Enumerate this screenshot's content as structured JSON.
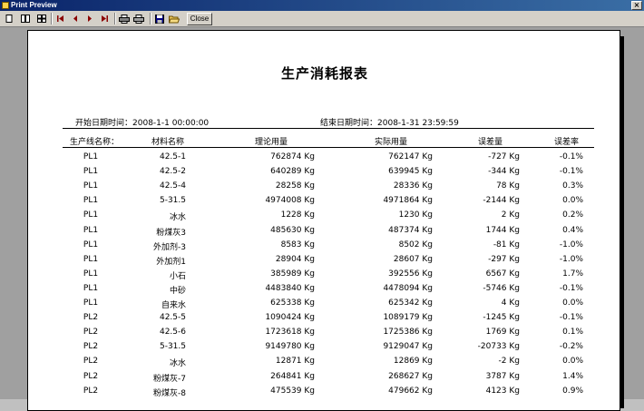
{
  "window": {
    "title": "Print Preview",
    "close_glyph": "×"
  },
  "toolbar": {
    "buttons": [
      {
        "name": "single-page-view",
        "icon": "single-page-icon"
      },
      {
        "name": "two-page-view",
        "icon": "two-page-icon"
      },
      {
        "name": "multi-page-view",
        "icon": "multi-page-icon"
      },
      {
        "name": "first-page",
        "icon": "first-page-icon"
      },
      {
        "name": "previous-page",
        "icon": "previous-page-icon"
      },
      {
        "name": "next-page",
        "icon": "next-page-icon"
      },
      {
        "name": "last-page",
        "icon": "last-page-icon"
      },
      {
        "name": "print-setup",
        "icon": "printer-setup-icon"
      },
      {
        "name": "print",
        "icon": "printer-icon"
      },
      {
        "name": "save",
        "icon": "floppy-disk-icon"
      },
      {
        "name": "open",
        "icon": "open-folder-icon"
      }
    ],
    "close_label": "Close"
  },
  "report": {
    "title": "生产消耗报表",
    "start_label": "开始日期时间：",
    "start_value": "2008-1-1 00:00:00",
    "end_label": "结束日期时间：",
    "end_value": "2008-1-31 23:59:59",
    "columns": [
      "生产线名称：",
      "材料名称",
      "理论用量",
      "实际用量",
      "误差量",
      "误差率"
    ],
    "rows": [
      {
        "line": "PL1",
        "material": "42.5-1",
        "theoretical": "762874 Kg",
        "actual": "762147 Kg",
        "error": "-727 Kg",
        "rate": "-0.1%"
      },
      {
        "line": "PL1",
        "material": "42.5-2",
        "theoretical": "640289 Kg",
        "actual": "639945 Kg",
        "error": "-344 Kg",
        "rate": "-0.1%"
      },
      {
        "line": "PL1",
        "material": "42.5-4",
        "theoretical": "28258 Kg",
        "actual": "28336 Kg",
        "error": "78 Kg",
        "rate": "0.3%"
      },
      {
        "line": "PL1",
        "material": "5-31.5",
        "theoretical": "4974008 Kg",
        "actual": "4971864 Kg",
        "error": "-2144 Kg",
        "rate": "0.0%"
      },
      {
        "line": "PL1",
        "material": "冰水",
        "theoretical": "1228 Kg",
        "actual": "1230 Kg",
        "error": "2 Kg",
        "rate": "0.2%"
      },
      {
        "line": "PL1",
        "material": "粉煤灰3",
        "theoretical": "485630 Kg",
        "actual": "487374 Kg",
        "error": "1744 Kg",
        "rate": "0.4%"
      },
      {
        "line": "PL1",
        "material": "外加剂-3",
        "theoretical": "8583 Kg",
        "actual": "8502 Kg",
        "error": "-81 Kg",
        "rate": "-1.0%"
      },
      {
        "line": "PL1",
        "material": "外加剂1",
        "theoretical": "28904 Kg",
        "actual": "28607 Kg",
        "error": "-297 Kg",
        "rate": "-1.0%"
      },
      {
        "line": "PL1",
        "material": "小石",
        "theoretical": "385989 Kg",
        "actual": "392556 Kg",
        "error": "6567 Kg",
        "rate": "1.7%"
      },
      {
        "line": "PL1",
        "material": "中砂",
        "theoretical": "4483840 Kg",
        "actual": "4478094 Kg",
        "error": "-5746 Kg",
        "rate": "-0.1%"
      },
      {
        "line": "PL1",
        "material": "自来水",
        "theoretical": "625338 Kg",
        "actual": "625342 Kg",
        "error": "4 Kg",
        "rate": "0.0%"
      },
      {
        "line": "PL2",
        "material": "42.5-5",
        "theoretical": "1090424 Kg",
        "actual": "1089179 Kg",
        "error": "-1245 Kg",
        "rate": "-0.1%"
      },
      {
        "line": "PL2",
        "material": "42.5-6",
        "theoretical": "1723618 Kg",
        "actual": "1725386 Kg",
        "error": "1769 Kg",
        "rate": "0.1%"
      },
      {
        "line": "PL2",
        "material": "5-31.5",
        "theoretical": "9149780 Kg",
        "actual": "9129047 Kg",
        "error": "-20733 Kg",
        "rate": "-0.2%"
      },
      {
        "line": "PL2",
        "material": "冰水",
        "theoretical": "12871 Kg",
        "actual": "12869 Kg",
        "error": "-2 Kg",
        "rate": "0.0%"
      },
      {
        "line": "PL2",
        "material": "粉煤灰-7",
        "theoretical": "264841 Kg",
        "actual": "268627 Kg",
        "error": "3787 Kg",
        "rate": "1.4%"
      },
      {
        "line": "PL2",
        "material": "粉煤灰-8",
        "theoretical": "475539 Kg",
        "actual": "479662 Kg",
        "error": "4123 Kg",
        "rate": "0.9%"
      }
    ]
  }
}
